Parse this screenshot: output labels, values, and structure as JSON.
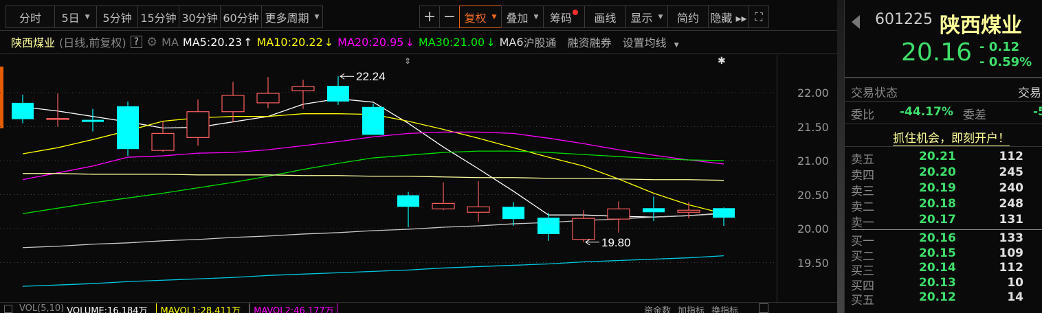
{
  "toolbar": {
    "periods": [
      {
        "label": "分时"
      },
      {
        "label": "5日",
        "dropdown": true
      },
      {
        "label": "5分钟"
      },
      {
        "label": "15分钟"
      },
      {
        "label": "30分钟"
      },
      {
        "label": "60分钟"
      },
      {
        "label": "更多周期",
        "dropdown": true
      }
    ],
    "zoom_in": "+",
    "zoom_out": "−",
    "fuquan": "复权",
    "diejia": "叠加",
    "chouma": "筹码",
    "huaxian": "画线",
    "xianshi": "显示",
    "jianyue": "简约",
    "yincang": "隐藏 ▸▸"
  },
  "info": {
    "stock": "陕西煤业",
    "mode": "(日线,前复权)",
    "help": "?",
    "ma": "MA",
    "ma5": "MA5:20.23",
    "ma5_dir": "↑",
    "ma10": "MA10:20.22",
    "ma10_dir": "↓",
    "ma20": "MA20:20.95",
    "ma20_dir": "↓",
    "ma30": "MA30:21.00",
    "ma30_dir": "↓",
    "ma6": "MA6",
    "hgt": "沪股通",
    "rzrq": "融资融券",
    "szjx": "设置均线"
  },
  "colors": {
    "up": "#ff5f5f",
    "down": "#00ffff",
    "ma5": "#ffffff",
    "ma10": "#ffff00",
    "ma20": "#ff00ff",
    "ma30": "#00e000",
    "price": "#3ede6a",
    "accent": "#f06a24"
  },
  "chart_data": {
    "type": "candlestick",
    "ylim": [
      19.2,
      22.4
    ],
    "yticks": [
      "22.00",
      "21.50",
      "21.00",
      "20.50",
      "20.00",
      "19.50"
    ],
    "ohlc": [
      [
        21.85,
        21.97,
        21.55,
        21.61
      ],
      [
        21.62,
        21.99,
        21.5,
        21.62
      ],
      [
        21.6,
        21.76,
        21.43,
        21.57
      ],
      [
        21.8,
        21.87,
        21.07,
        21.17
      ],
      [
        21.15,
        21.58,
        21.13,
        21.4
      ],
      [
        21.34,
        21.9,
        21.22,
        21.72
      ],
      [
        21.72,
        22.16,
        21.56,
        21.96
      ],
      [
        21.85,
        22.23,
        21.77,
        21.99
      ],
      [
        22.03,
        22.19,
        21.76,
        22.09
      ],
      [
        22.1,
        22.24,
        21.82,
        21.87
      ],
      [
        21.79,
        21.84,
        21.38,
        21.38
      ],
      [
        20.49,
        20.54,
        20.02,
        20.32
      ],
      [
        20.29,
        20.68,
        20.27,
        20.37
      ],
      [
        20.24,
        20.7,
        20.1,
        20.32
      ],
      [
        20.32,
        20.39,
        20.04,
        20.14
      ],
      [
        20.16,
        20.23,
        19.82,
        19.92
      ],
      [
        19.84,
        20.27,
        19.8,
        20.15
      ],
      [
        20.14,
        20.4,
        19.94,
        20.29
      ],
      [
        20.3,
        20.47,
        20.11,
        20.24
      ],
      [
        20.24,
        20.39,
        20.15,
        20.27
      ],
      [
        20.3,
        20.31,
        20.04,
        20.16
      ]
    ],
    "series": [
      {
        "name": "MA5",
        "color": "#ffffff",
        "values": [
          21.79,
          21.73,
          21.65,
          21.57,
          21.48,
          21.49,
          21.57,
          21.65,
          21.83,
          21.91,
          21.86,
          21.55,
          21.2,
          20.88,
          20.55,
          20.2,
          20.2,
          20.18,
          20.17,
          20.19,
          20.23
        ]
      },
      {
        "name": "MA10",
        "color": "#ffff00",
        "values": [
          21.1,
          21.19,
          21.31,
          21.44,
          21.58,
          21.63,
          21.65,
          21.65,
          21.69,
          21.69,
          21.68,
          21.58,
          21.46,
          21.33,
          21.19,
          21.05,
          20.92,
          20.73,
          20.52,
          20.35,
          20.22
        ]
      },
      {
        "name": "MA20",
        "color": "#ff00ff",
        "values": [
          20.72,
          20.82,
          20.92,
          21.05,
          21.07,
          21.11,
          21.12,
          21.16,
          21.22,
          21.28,
          21.35,
          21.4,
          21.42,
          21.42,
          21.4,
          21.33,
          21.25,
          21.16,
          21.08,
          21.01,
          20.95
        ]
      },
      {
        "name": "MA30",
        "color": "#00e000",
        "values": [
          20.22,
          20.3,
          20.38,
          20.45,
          20.52,
          20.6,
          20.68,
          20.77,
          20.87,
          20.96,
          21.04,
          21.08,
          21.12,
          21.14,
          21.14,
          21.12,
          21.09,
          21.06,
          21.03,
          21.01,
          21.0
        ]
      },
      {
        "name": "MA60",
        "color": "#ffffa0",
        "values": [
          20.81,
          20.81,
          20.8,
          20.8,
          20.8,
          20.79,
          20.79,
          20.79,
          20.78,
          20.78,
          20.77,
          20.77,
          20.76,
          20.75,
          20.75,
          20.74,
          20.74,
          20.73,
          20.72,
          20.72,
          20.71
        ]
      },
      {
        "name": "MA120",
        "color": "#c8c8c8",
        "values": [
          19.72,
          19.74,
          19.77,
          19.79,
          19.82,
          19.84,
          19.87,
          19.89,
          19.92,
          19.94,
          19.97,
          19.99,
          20.02,
          20.04,
          20.07,
          20.09,
          20.12,
          20.14,
          20.17,
          20.19,
          20.22
        ]
      },
      {
        "name": "MA250",
        "color": "#00c8e0",
        "values": [
          19.15,
          19.17,
          19.19,
          19.22,
          19.24,
          19.26,
          19.28,
          19.31,
          19.33,
          19.35,
          19.37,
          19.39,
          19.42,
          19.44,
          19.46,
          19.48,
          19.51,
          19.53,
          19.55,
          19.57,
          19.6
        ]
      }
    ],
    "annotations": {
      "high": "22.24",
      "low": "19.80"
    }
  },
  "bottom": {
    "vol": "VOL(5,10)",
    "volume": "VOLUME:16.184万",
    "mavol1": "MAVOL1:28.411万",
    "mavol2": "MAVOL2:46.177万",
    "zjs": "资金数",
    "jzb": "加指标",
    "hzb": "换指标"
  },
  "quote": {
    "code": "601225",
    "name": "陕西煤业",
    "price": "20.16",
    "change": "- 0.12",
    "pct": "- 0.59%",
    "status_label": "交易状态",
    "status_value": "交易",
    "wb_label": "委比",
    "wb_value": "-44.17%",
    "wc_label": "委差",
    "wc_value": "-5",
    "promo": "抓住机会，即刻开户！"
  },
  "orderbook": {
    "asks": [
      {
        "label": "卖五",
        "price": "20.21",
        "vol": "112"
      },
      {
        "label": "卖四",
        "price": "20.20",
        "vol": "245"
      },
      {
        "label": "卖三",
        "price": "20.19",
        "vol": "240"
      },
      {
        "label": "卖二",
        "price": "20.18",
        "vol": "248"
      },
      {
        "label": "卖一",
        "price": "20.17",
        "vol": "131"
      }
    ],
    "bids": [
      {
        "label": "买一",
        "price": "20.16",
        "vol": "133"
      },
      {
        "label": "买二",
        "price": "20.15",
        "vol": "109"
      },
      {
        "label": "买三",
        "price": "20.14",
        "vol": "112"
      },
      {
        "label": "买四",
        "price": "20.13",
        "vol": "10"
      },
      {
        "label": "买五",
        "price": "20.12",
        "vol": "14"
      }
    ]
  }
}
